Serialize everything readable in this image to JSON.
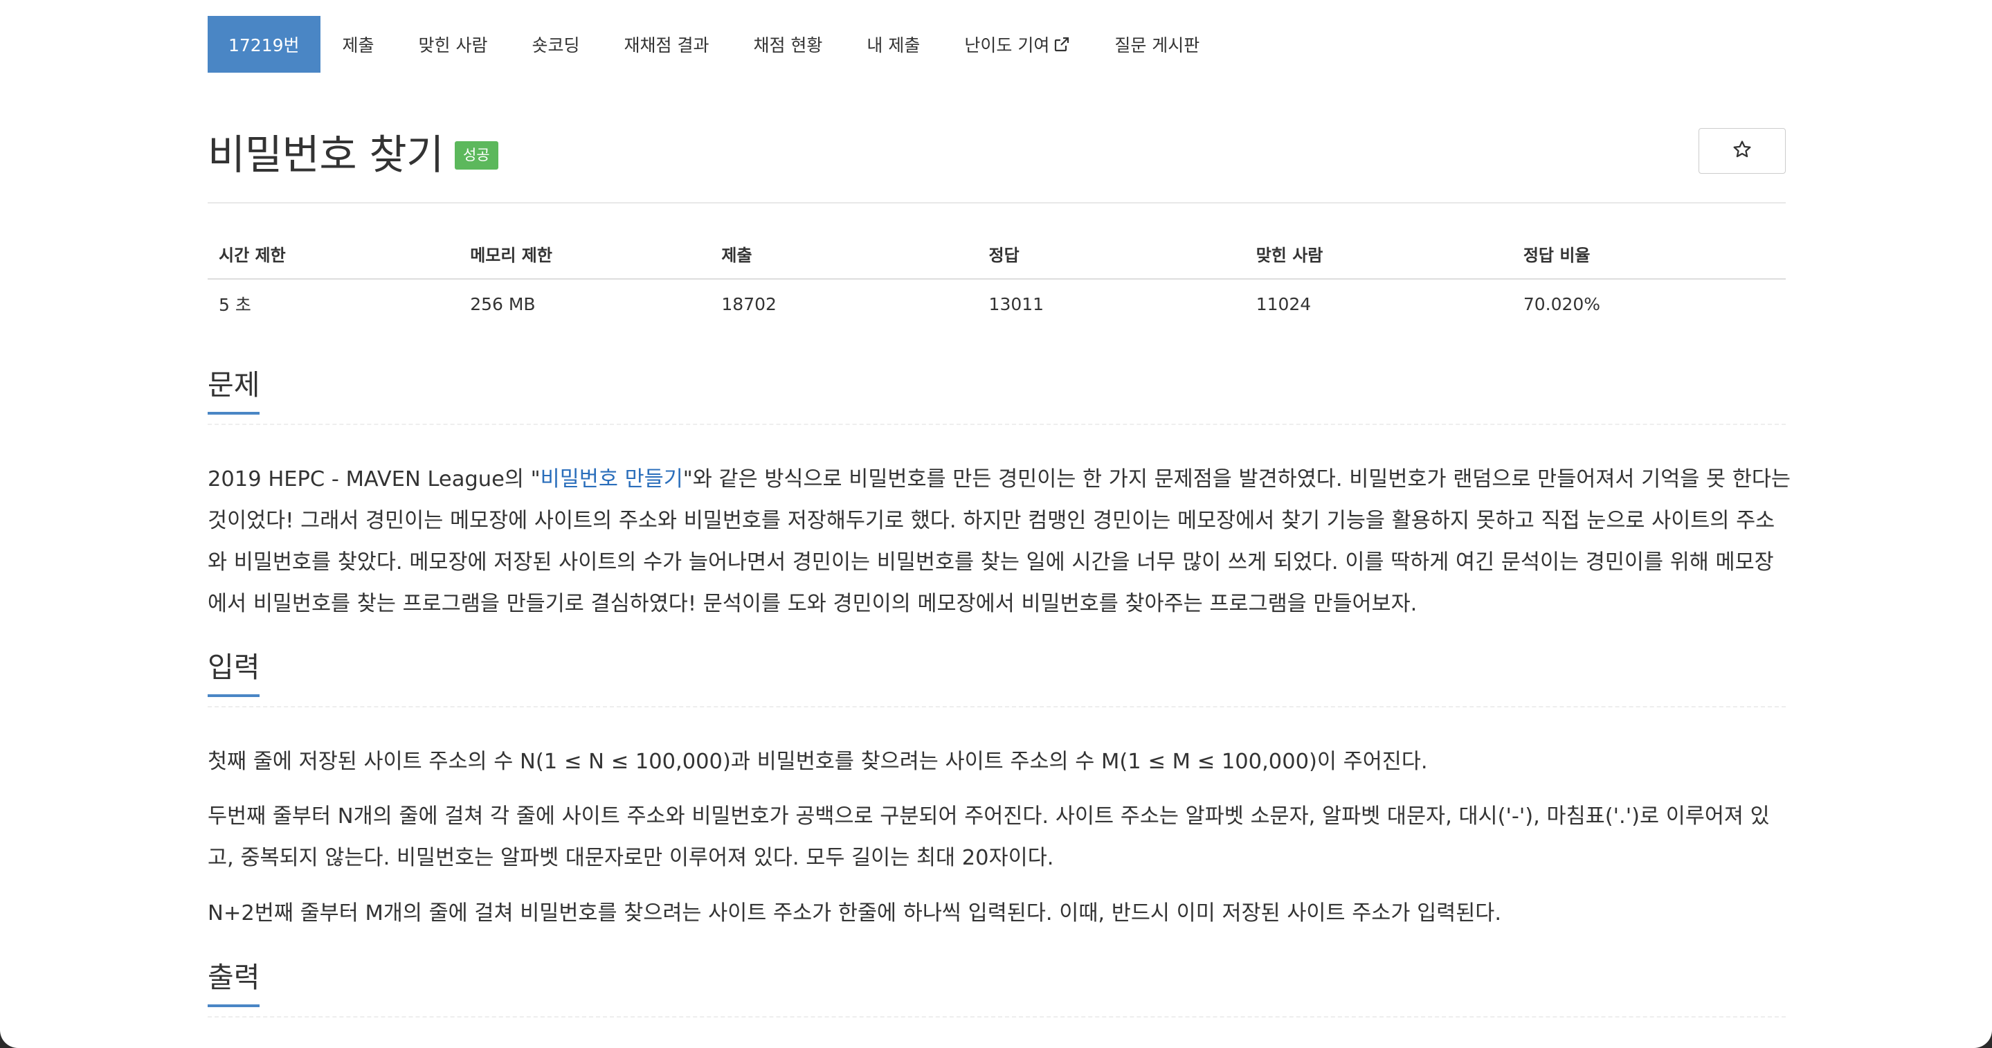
{
  "nav": {
    "items": [
      {
        "label": "17219번",
        "active": true
      },
      {
        "label": "제출"
      },
      {
        "label": "맞힌 사람"
      },
      {
        "label": "숏코딩"
      },
      {
        "label": "재채점 결과"
      },
      {
        "label": "채점 현황"
      },
      {
        "label": "내 제출"
      },
      {
        "label": "난이도 기여",
        "icon": "external-link-icon"
      },
      {
        "label": "질문 게시판"
      }
    ]
  },
  "problem": {
    "title": "비밀번호 찾기",
    "status_badge": "성공",
    "star_icon": "star-outline-icon"
  },
  "stats": {
    "headers": [
      "시간 제한",
      "메모리 제한",
      "제출",
      "정답",
      "맞힌 사람",
      "정답 비율"
    ],
    "values": [
      "5 초",
      "256 MB",
      "18702",
      "13011",
      "11024",
      "70.020%"
    ]
  },
  "sections": {
    "description": {
      "title": "문제",
      "text_before_link": "2019 HEPC - MAVEN League의 \"",
      "link_text": "비밀번호 만들기",
      "text_after_link": "\"와 같은 방식으로 비밀번호를 만든 경민이는 한 가지 문제점을 발견하였다. 비밀번호가 랜덤으로 만들어져서 기억을 못 한다는 것이었다! 그래서 경민이는 메모장에 사이트의 주소와 비밀번호를 저장해두기로 했다. 하지만 컴맹인 경민이는 메모장에서 찾기 기능을 활용하지 못하고 직접 눈으로 사이트의 주소와 비밀번호를 찾았다. 메모장에 저장된 사이트의 수가 늘어나면서 경민이는 비밀번호를 찾는 일에 시간을 너무 많이 쓰게 되었다. 이를 딱하게 여긴 문석이는 경민이를 위해 메모장에서 비밀번호를 찾는 프로그램을 만들기로 결심하였다! 문석이를 도와 경민이의 메모장에서 비밀번호를 찾아주는 프로그램을 만들어보자."
    },
    "input": {
      "title": "입력",
      "paragraphs": [
        "첫째 줄에 저장된 사이트 주소의 수 N(1 ≤ N ≤ 100,000)과 비밀번호를 찾으려는 사이트 주소의 수 M(1 ≤ M ≤ 100,000)이 주어진다.",
        "두번째 줄부터 N개의 줄에 걸쳐 각 줄에 사이트 주소와 비밀번호가 공백으로 구분되어 주어진다. 사이트 주소는 알파벳 소문자, 알파벳 대문자, 대시('-'), 마침표('.')로 이루어져 있고, 중복되지 않는다. 비밀번호는 알파벳 대문자로만 이루어져 있다. 모두 길이는 최대 20자이다.",
        "N+2번째 줄부터 M개의 줄에 걸쳐 비밀번호를 찾으려는 사이트 주소가 한줄에 하나씩 입력된다. 이때, 반드시 이미 저장된 사이트 주소가 입력된다."
      ]
    },
    "output": {
      "title": "출력"
    }
  },
  "colors": {
    "accent": "#4a86c5",
    "success": "#5cb85c",
    "link": "#2a6ebb"
  }
}
